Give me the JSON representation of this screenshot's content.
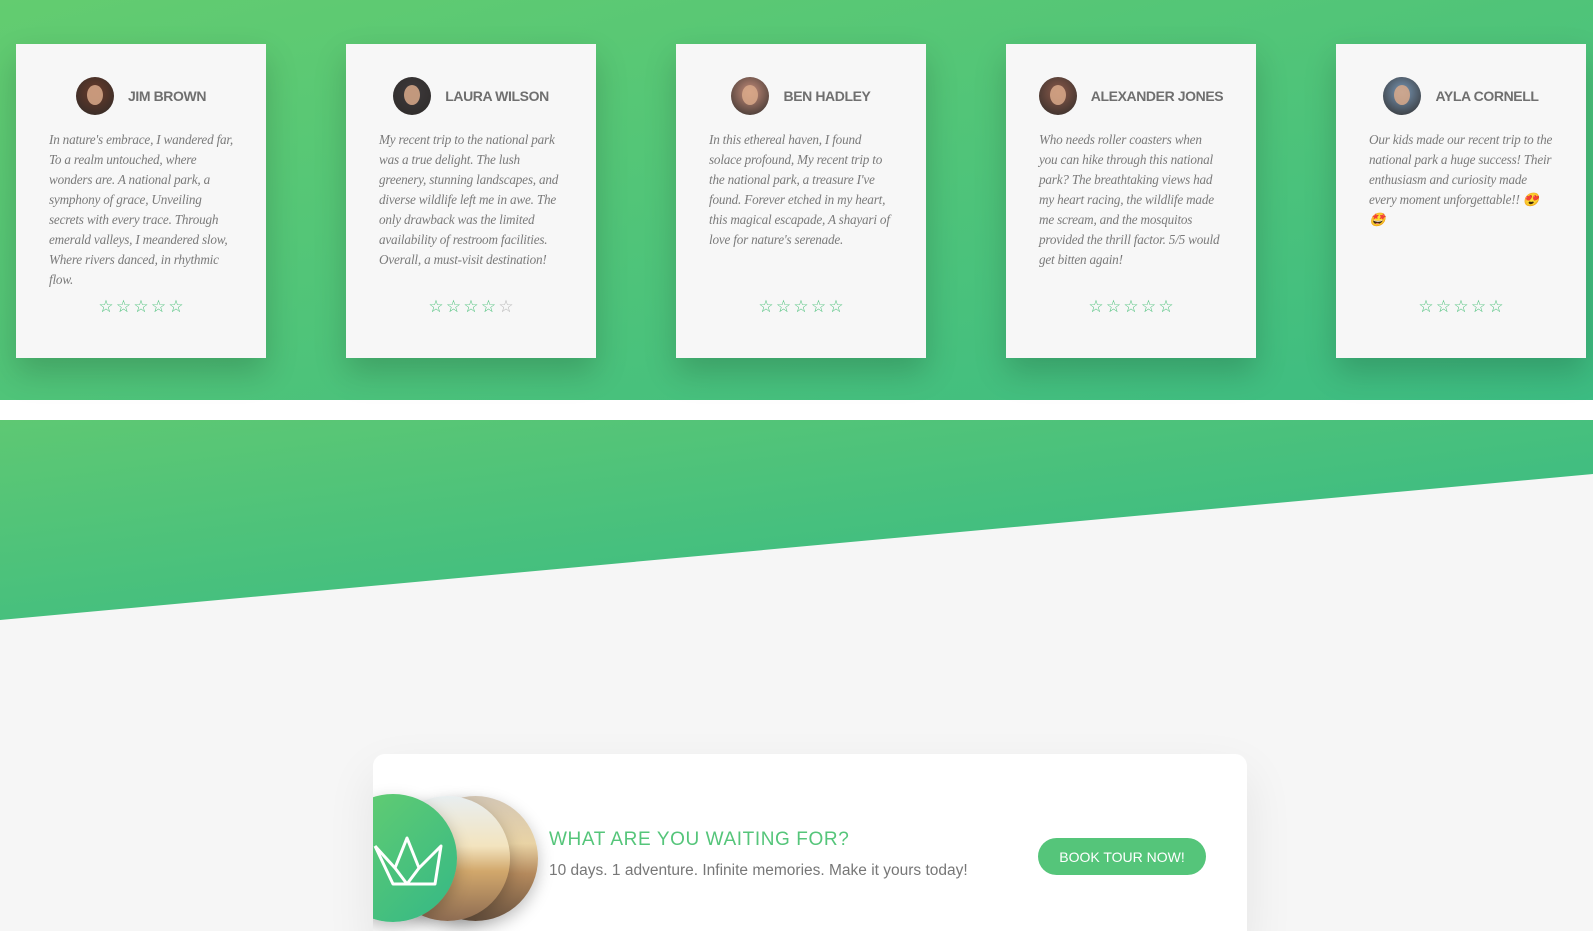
{
  "colors": {
    "accent": "#55c57a",
    "gradient_start": "#63cc70",
    "gradient_end": "#3cbc82",
    "star_on": "#4bc07a",
    "star_off": "#b5b5b5"
  },
  "reviews": [
    {
      "name": "JIM BROWN",
      "avatar_icon": "person-avatar",
      "text": "In nature's embrace, I wandered far, To a realm untouched, where wonders are. A national park, a symphony of grace, Unveiling secrets with every trace. Through emerald valleys, I meandered slow, Where rivers danced, in rhythmic flow.",
      "rating": 5
    },
    {
      "name": "LAURA WILSON",
      "avatar_icon": "person-avatar",
      "text": "My recent trip to the national park was a true delight. The lush greenery, stunning landscapes, and diverse wildlife left me in awe. The only drawback was the limited availability of restroom facilities. Overall, a must-visit destination!",
      "rating": 4
    },
    {
      "name": "BEN HADLEY",
      "avatar_icon": "person-avatar",
      "text": "In this ethereal haven, I found solace profound, My recent trip to the national park, a treasure I've found. Forever etched in my heart, this magical escapade, A shayari of love for nature's serenade.",
      "rating": 5
    },
    {
      "name": "ALEXANDER JONES",
      "avatar_icon": "person-avatar",
      "text": "Who needs roller coasters when you can hike through this national park? The breathtaking views had my heart racing, the wildlife made me scream, and the mosquitos provided the thrill factor. 5/5 would get bitten again!",
      "rating": 5
    },
    {
      "name": "AYLA CORNELL",
      "avatar_icon": "person-avatar",
      "text": "Our kids made our recent trip to the national park a huge success! Their enthusiasm and curiosity made every moment unforgettable!! 😍 🤩",
      "rating": 5
    }
  ],
  "cta": {
    "title": "WHAT ARE YOU WAITING FOR?",
    "subtitle": "10 days. 1 adventure. Infinite memories. Make it yours today!",
    "button_label": "BOOK TOUR NOW!",
    "logo_icon": "crown-icon"
  }
}
